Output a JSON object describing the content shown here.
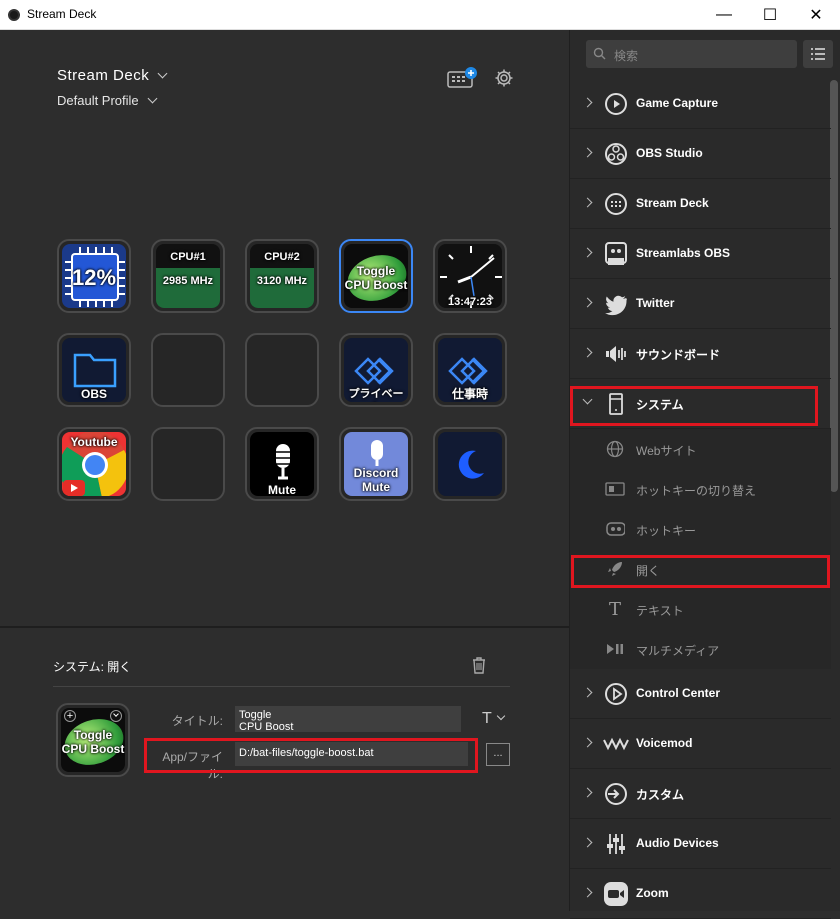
{
  "window": {
    "title": "Stream Deck",
    "minimize": "—",
    "maximize": "☐",
    "close": "✕"
  },
  "header": {
    "device_name": "Stream Deck",
    "profile_name": "Default Profile"
  },
  "keys": {
    "k1": {
      "text": "12%"
    },
    "k2": {
      "top": "CPU#1",
      "bottom": "2985 MHz"
    },
    "k3": {
      "top": "CPU#2",
      "bottom": "3120 MHz"
    },
    "k4": {
      "line1": "Toggle",
      "line2": "CPU Boost"
    },
    "k5": {
      "text": "13:47:23"
    },
    "k6": {
      "text": "OBS"
    },
    "k9": {
      "text": "プライベート"
    },
    "k10": {
      "text": "仕事時"
    },
    "k11": {
      "text": "Youtube"
    },
    "k13": {
      "text": "Mute"
    },
    "k14": {
      "line1": "Discord",
      "line2": "Mute"
    }
  },
  "inspector": {
    "section_title": "システム: 開く",
    "preview_line1": "Toggle",
    "preview_line2": "CPU Boost",
    "title_label": "タイトル:",
    "title_value_line1": "Toggle",
    "title_value_line2": "CPU Boost",
    "app_label": "App/ファイル:",
    "app_value": "D:/bat-files/toggle-boost.bat",
    "browse_label": "...",
    "font_icon": "T"
  },
  "sidebar": {
    "search_placeholder": "検索",
    "categories": [
      {
        "label": "Game Capture",
        "icon": "play-circle-icon"
      },
      {
        "label": "OBS Studio",
        "icon": "obs-icon"
      },
      {
        "label": "Stream Deck",
        "icon": "stream-deck-icon"
      },
      {
        "label": "Streamlabs OBS",
        "icon": "streamlabs-icon"
      },
      {
        "label": "Twitter",
        "icon": "twitter-icon"
      },
      {
        "label": "サウンドボード",
        "icon": "speaker-icon"
      },
      {
        "label": "システム",
        "icon": "system-icon"
      }
    ],
    "system_items": [
      {
        "label": "Webサイト",
        "icon": "globe-icon"
      },
      {
        "label": "ホットキーの切り替え",
        "icon": "hotkey-switch-icon"
      },
      {
        "label": "ホットキー",
        "icon": "hotkey-icon"
      },
      {
        "label": "開く",
        "icon": "rocket-icon"
      },
      {
        "label": "テキスト",
        "icon": "text-icon"
      },
      {
        "label": "マルチメディア",
        "icon": "multimedia-icon"
      }
    ],
    "more_categories": [
      {
        "label": "Control Center",
        "icon": "control-center-icon"
      },
      {
        "label": "Voicemod",
        "icon": "voicemod-icon"
      },
      {
        "label": "カスタム",
        "icon": "custom-icon"
      },
      {
        "label": "Audio Devices",
        "icon": "audio-devices-icon"
      },
      {
        "label": "Zoom",
        "icon": "zoom-icon"
      }
    ]
  },
  "colors": {
    "accent_blue": "#3b87f5",
    "highlight_red": "#e0161f",
    "cpu_green": "#1f6b3a"
  }
}
